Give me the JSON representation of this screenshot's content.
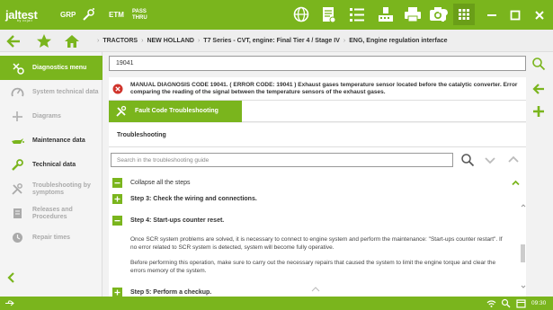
{
  "app": {
    "logo_text": "jaltest",
    "logo_subtext": "by cojali",
    "grp_label": "GRP",
    "etm_label": "ETM",
    "pass_line1": "PASS",
    "pass_line2": "THRU"
  },
  "toolbar_icons": [
    "globe-icon",
    "document-icon",
    "list-icon",
    "keyboard-icon",
    "printer-icon",
    "camera-icon",
    "help-icon",
    "apps-grid-icon"
  ],
  "window_controls": [
    "minimize-icon",
    "maximize-icon",
    "close-icon"
  ],
  "colors": {
    "brand_green": "#7ab51d",
    "error_red": "#d0342c",
    "active_green": "#7ab51d"
  },
  "breadcrumb": {
    "items": [
      "TRACTORS",
      "NEW HOLLAND",
      "T7 Series - CVT, engine: Final Tier 4 / Stage IV",
      "ENG, Engine regulation interface"
    ]
  },
  "sidebar": {
    "items": [
      {
        "label": "Diagnostics menu",
        "icon": "diagnostics-icon",
        "active": true
      },
      {
        "label": "System technical data",
        "icon": "gauge-icon",
        "active": false
      },
      {
        "label": "Diagrams",
        "icon": "diagram-icon",
        "active": false
      },
      {
        "label": "Maintenance data",
        "icon": "oil-can-icon",
        "active": false
      },
      {
        "label": "Technical data",
        "icon": "wrench-icon",
        "active": false
      },
      {
        "label": "Troubleshooting by symptoms",
        "icon": "tools-icon",
        "active": false
      },
      {
        "label": "Releases and Procedures",
        "icon": "releases-icon",
        "active": false
      },
      {
        "label": "Repair times",
        "icon": "clock-icon",
        "active": false
      }
    ]
  },
  "main": {
    "search_value": "19041",
    "error_message": "MANUAL DIAGNOSIS CODE 19041. ( ERROR CODE: 19041 ) Exhaust gases temperature sensor located before the catalytic converter. Error comparing the reading of the signal between the temperature sensors of the exhaust gases.",
    "tab_label": "Fault Code Troubleshooting",
    "section_title": "Troubleshooting",
    "guide_placeholder": "Search in the troubleshooting guide",
    "collapse_label": "Collapse all the steps",
    "step3_title": "Step 3: Check the wiring and connections.",
    "step4_title": "Step 4: Start-ups counter reset.",
    "step4_para1": "Once SCR system problems are solved, it is necessary to connect to engine system and perform the maintenance: \"Start-ups counter restart\". If no error related to SCR system is detected, system will become fully operative.",
    "step4_para2": "Before performing this operation, make sure to carry out the necessary repairs that caused the system to limit the engine torque and clear the errors memory of the system.",
    "step5_title": "Step 5: Perform a checkup."
  },
  "status": {
    "time": "09:30"
  }
}
